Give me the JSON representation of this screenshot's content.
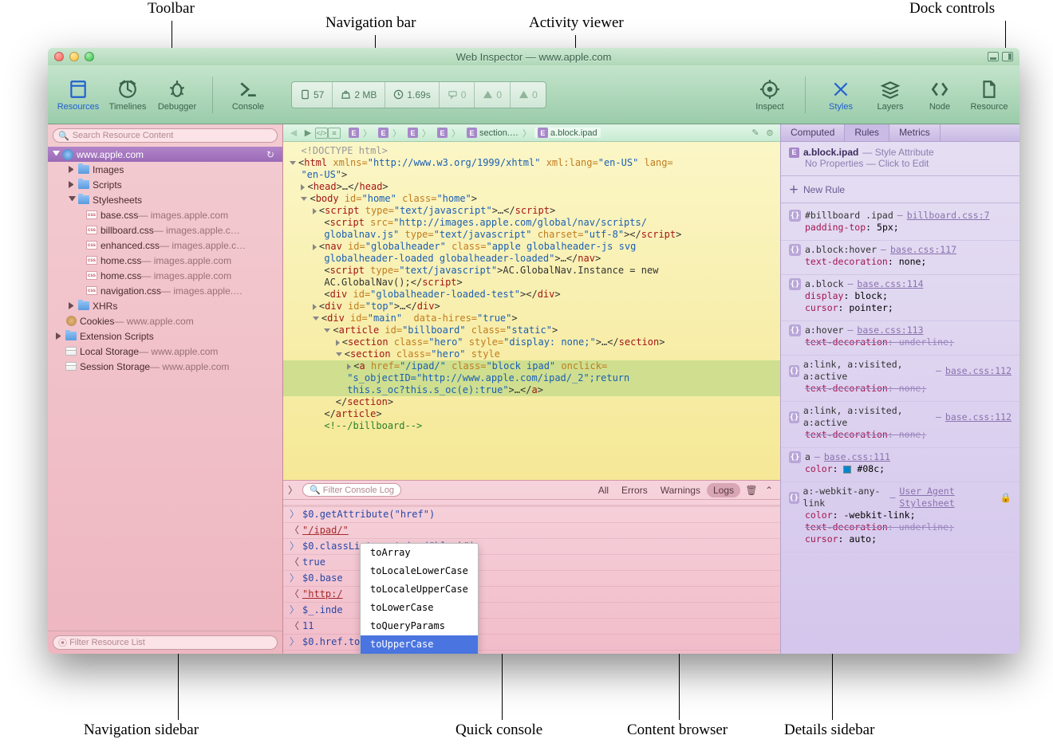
{
  "callouts": {
    "toolbar": "Toolbar",
    "navbar": "Navigation bar",
    "activity": "Activity viewer",
    "dock": "Dock controls",
    "navsidebar": "Navigation sidebar",
    "quickconsole": "Quick console",
    "contentbrowser": "Content browser",
    "detailssidebar": "Details sidebar"
  },
  "window_title": "Web Inspector — www.apple.com",
  "toolbar": {
    "resources": "Resources",
    "timelines": "Timelines",
    "debugger": "Debugger",
    "console": "Console",
    "inspect": "Inspect",
    "styles": "Styles",
    "layers": "Layers",
    "node": "Node",
    "resource": "Resource"
  },
  "activity": {
    "docs": "57",
    "size": "2 MB",
    "time": "1.69s",
    "logs": "0",
    "warnings": "0",
    "errors": "0"
  },
  "nav": {
    "search_placeholder": "Search Resource Content",
    "root": "www.apple.com",
    "images": "Images",
    "scripts": "Scripts",
    "stylesheets": "Stylesheets",
    "css": [
      {
        "file": "base.css",
        "origin": " — images.apple.com"
      },
      {
        "file": "billboard.css",
        "origin": " — images.apple.c…"
      },
      {
        "file": "enhanced.css",
        "origin": " — images.apple.c…"
      },
      {
        "file": "home.css",
        "origin": " — images.apple.com"
      },
      {
        "file": "home.css",
        "origin": " — images.apple.com"
      },
      {
        "file": "navigation.css",
        "origin": " — images.apple.…"
      }
    ],
    "xhrs": "XHRs",
    "cookies": "Cookies",
    "cookies_origin": " — www.apple.com",
    "ext_scripts": "Extension Scripts",
    "local_storage": "Local Storage",
    "local_origin": " — www.apple.com",
    "session_storage": "Session Storage",
    "session_origin": " — www.apple.com",
    "filter_placeholder": "Filter Resource List"
  },
  "crumbs": {
    "c1": "E",
    "c2": "E",
    "c3": "E",
    "c4": "E",
    "section": "section.…",
    "ablock": "a.block.ipad"
  },
  "dom": {
    "l0": "<!DOCTYPE html>",
    "l1a": "html",
    "l1b": " xmlns=",
    "l1c": "\"http://www.w3.org/1999/xhtml\"",
    "l1d": " xml:lang=",
    "l1e": "\"en-US\"",
    "l1f": " lang=",
    "l1g": "\"en-US\"",
    "l2": "head",
    "l2t": "…",
    "l3": "body",
    "l3a": " id=",
    "l3b": "\"home\"",
    "l3c": " class=",
    "l3d": "\"home\"",
    "l4": "script",
    "l4a": " type=",
    "l4b": "\"text/javascript\"",
    "l4t": "…",
    "l5": "script",
    "l5a": " src=",
    "l5b": "\"http://images.apple.com/global/nav/scripts/",
    "l5c": "globalnav.js\"",
    "l5d": " type=",
    "l5e": "\"text/javascript\"",
    "l5f": " charset=",
    "l5g": "\"utf-8\"",
    "l6": "nav",
    "l6a": " id=",
    "l6b": "\"globalheader\"",
    "l6c": " class=",
    "l6d": "\"apple globalheader-js svg",
    "l6e": "globalheader-loaded globalheader-loaded\"",
    "l6t": "…",
    "l7": "script",
    "l7a": " type=",
    "l7b": "\"text/javascript\"",
    "l7t": "AC.GlobalNav.Instance = new",
    "l7u": "AC.GlobalNav();",
    "l8": "div",
    "l8a": " id=",
    "l8b": "\"globalheader-loaded-test\"",
    "l9": "div",
    "l9a": " id=",
    "l9b": "\"top\"",
    "l9t": "…",
    "l10": "div",
    "l10a": " id=",
    "l10b": "\"main\"",
    "l10c": "  data-hires=",
    "l10d": "\"true\"",
    "l11": "article",
    "l11a": " id=",
    "l11b": "\"billboard\"",
    "l11c": " class=",
    "l11d": "\"static\"",
    "l12": "section",
    "l12a": " class=",
    "l12b": "\"hero\"",
    "l12c": " style=",
    "l12d": "\"display: none;\"",
    "l12t": "…",
    "l13": "section",
    "l13a": " class=",
    "l13b": "\"hero\"",
    "l13c": " style",
    "l14": "a",
    "l14a": " href=",
    "l14b": "\"/ipad/\"",
    "l14c": " class=",
    "l14d": "\"block ipad\"",
    "l14e": " onclick=",
    "l14f": "\"s_objectID=\"http://www.apple.com/ipad/_2\";return",
    "l14g": "this.s_oc?this.s_oc(e):true\"",
    "l14t": "…",
    "l15": "section",
    "l16": "article",
    "l17": "<!--/billboard-->"
  },
  "console": {
    "filter_placeholder": "Filter Console Log",
    "all": "All",
    "errors": "Errors",
    "warnings": "Warnings",
    "logs": "Logs",
    "r1": "$0.getAttribute(\"href\")",
    "r2": "\"/ipad/\"",
    "r3": "$0.classList.contains(\"block\")",
    "r4": "true",
    "r5": "$0.base",
    "r6": "\"http:/",
    "r7": "$_.inde",
    "r8": "11",
    "r9": "$0.href.toUpperCase",
    "ac": [
      "toArray",
      "toLocaleLowerCase",
      "toLocaleUpperCase",
      "toLowerCase",
      "toQueryParams",
      "toUpperCase"
    ]
  },
  "details": {
    "tabs": {
      "computed": "Computed",
      "rules": "Rules",
      "metrics": "Metrics"
    },
    "header_sel": "a.block.ipad",
    "header_src": " — Style Attribute",
    "header_sub": "No Properties — Click to Edit",
    "new_rule": "New Rule",
    "rules": [
      {
        "sel": "#billboard .ipad",
        "src": "billboard.css:7",
        "decls": [
          {
            "p": "padding-top",
            "v": "5px",
            "s": false
          }
        ]
      },
      {
        "sel": "a.block:hover",
        "src": "base.css:117",
        "decls": [
          {
            "p": "text-decoration",
            "v": "none",
            "s": false
          }
        ]
      },
      {
        "sel": "a.block",
        "src": "base.css:114",
        "decls": [
          {
            "p": "display",
            "v": "block",
            "s": false
          },
          {
            "p": "cursor",
            "v": "pointer",
            "s": false
          }
        ]
      },
      {
        "sel": "a:hover",
        "src": "base.css:113",
        "decls": [
          {
            "p": "text-decoration",
            "v": "underline",
            "s": true
          }
        ]
      },
      {
        "sel": "a:link, a:visited, a:active",
        "src": "base.css:112",
        "decls": [
          {
            "p": "text-decoration",
            "v": "none",
            "s": true
          }
        ]
      },
      {
        "sel": "a:link, a:visited, a:active",
        "src": "base.css:112",
        "decls": [
          {
            "p": "text-decoration",
            "v": "none",
            "s": true
          }
        ]
      },
      {
        "sel": "a",
        "src": "base.css:111",
        "decls": [
          {
            "p": "color",
            "v": "#08c",
            "s": false,
            "swatch": "#0088cc"
          }
        ]
      },
      {
        "sel": "a:-webkit-any-link",
        "src": "User Agent Stylesheet",
        "lock": true,
        "decls": [
          {
            "p": "color",
            "v": "-webkit-link",
            "s": false
          },
          {
            "p": "text-decoration",
            "v": "underline",
            "s": true
          },
          {
            "p": "cursor",
            "v": "auto",
            "s": false
          }
        ]
      }
    ]
  }
}
